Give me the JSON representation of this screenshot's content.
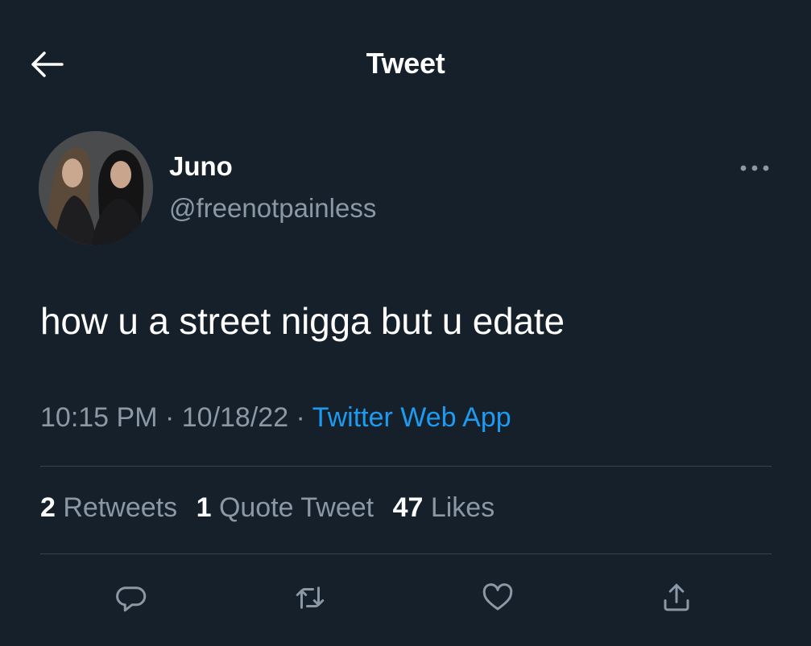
{
  "header": {
    "title": "Tweet",
    "back_icon": "arrow-left-icon"
  },
  "author": {
    "display_name": "Juno",
    "handle": "@freenotpainless",
    "more_icon": "more-horizontal-icon"
  },
  "tweet": {
    "text": "how u a street nigga but u edate",
    "time": "10:15 PM",
    "date": "10/18/22",
    "separator": " · ",
    "source": "Twitter Web App"
  },
  "stats": {
    "retweets_count": "2",
    "retweets_label": "Retweets",
    "quotes_count": "1",
    "quotes_label": "Quote Tweet",
    "likes_count": "47",
    "likes_label": "Likes"
  },
  "actions": [
    {
      "icon": "reply-icon"
    },
    {
      "icon": "retweet-icon"
    },
    {
      "icon": "like-icon"
    },
    {
      "icon": "share-icon"
    }
  ],
  "colors": {
    "background": "#15202b",
    "text_primary": "#ffffff",
    "text_secondary": "#8b98a5",
    "accent": "#1d9bf0",
    "divider": "#38444d"
  }
}
